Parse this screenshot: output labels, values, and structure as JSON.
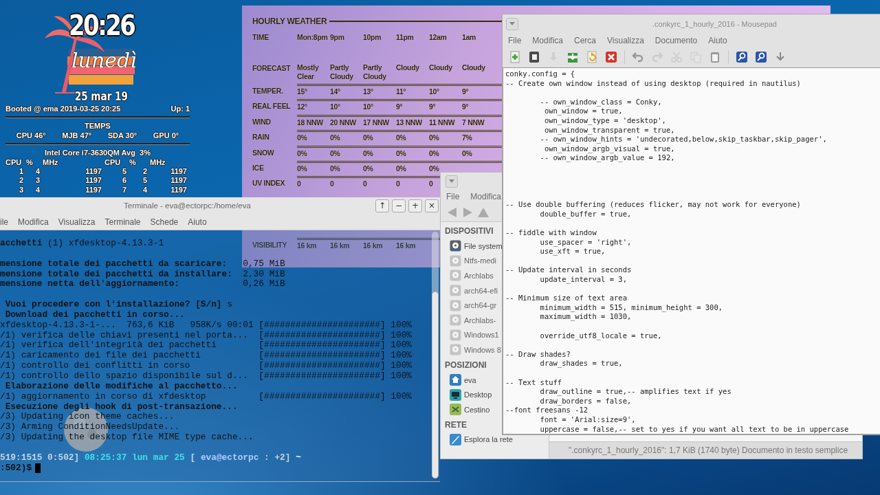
{
  "conky_clock": {
    "time": "20:26",
    "day": "lunedì",
    "date": "25 mar 19"
  },
  "conky_system": {
    "booted": "Booted @ ema 2019-03-25 20:25",
    "uptime": "Up: 1",
    "temps_title": "TEMPS",
    "temps": [
      "CPU 46°",
      "MJB 47°",
      "SDA 30°",
      "GPU 0°"
    ],
    "cpu_title": "Intel Core i7-3630QM Avg  3%",
    "cpu_headers": [
      "CPU",
      "%",
      "MHz",
      "CPU",
      "%",
      "MHz"
    ],
    "cpu_rows": [
      [
        "1",
        "4",
        "1197",
        "5",
        "2",
        "1197"
      ],
      [
        "2",
        "3",
        "1197",
        "6",
        "5",
        "1197"
      ],
      [
        "3",
        "4",
        "1197",
        "7",
        "4",
        "1197"
      ]
    ]
  },
  "weather": {
    "title": "HOURLY WEATHER",
    "rows": [
      {
        "label": "TIME",
        "values": [
          "Mon:8pm",
          "9pm",
          "10pm",
          "11pm",
          "12am",
          "1am"
        ]
      },
      {
        "label": "FORECAST",
        "values": [
          "Mostly Clear",
          "Partly Cloudy",
          "Partly Cloudy",
          "Cloudy",
          "Cloudy",
          "Cloudy"
        ]
      },
      {
        "label": "TEMPER.",
        "values": [
          "15°",
          "14°",
          "13°",
          "11°",
          "10°",
          "9°"
        ]
      },
      {
        "label": "REAL FEEL",
        "values": [
          "12°",
          "10°",
          "10°",
          "9°",
          "9°",
          "9°"
        ]
      },
      {
        "label": "WIND",
        "values": [
          "18 NNW",
          "20 NNW",
          "17 NNW",
          "13 NNW",
          "11 NNW",
          "7 NNW"
        ]
      },
      {
        "label": "RAIN",
        "values": [
          "0%",
          "0%",
          "0%",
          "0%",
          "0%",
          "7%"
        ]
      },
      {
        "label": "SNOW",
        "values": [
          "0%",
          "0%",
          "0%",
          "0%",
          "0%",
          "0%"
        ]
      },
      {
        "label": "ICE",
        "values": [
          "0%",
          "0%",
          "0%",
          "0%",
          "0%"
        ]
      },
      {
        "label": "UV INDEX",
        "values": [
          "0",
          "0",
          "0",
          "0",
          "0"
        ]
      }
    ],
    "lower_rows": [
      {
        "label": "VISIBILITY",
        "values": [
          "16 km",
          "16 km",
          "16 km",
          "16 km"
        ]
      }
    ]
  },
  "thunar": {
    "menu": [
      "File",
      "Modifica"
    ],
    "sidebar": [
      {
        "title": "DISPOSITIVI",
        "items": [
          {
            "label": "File system",
            "kind": "drive",
            "mounted": true
          },
          {
            "label": "Ntfs-medi",
            "kind": "drive",
            "mounted": false
          },
          {
            "label": "Archlabs",
            "kind": "drive",
            "mounted": false
          },
          {
            "label": "arch64-efi",
            "kind": "drive",
            "mounted": false
          },
          {
            "label": "arch64-gr",
            "kind": "drive",
            "mounted": false
          },
          {
            "label": "Archlabs-",
            "kind": "drive",
            "mounted": false
          },
          {
            "label": "Windows1",
            "kind": "drive",
            "mounted": false
          },
          {
            "label": "Windows 8",
            "kind": "drive",
            "mounted": false
          }
        ]
      },
      {
        "title": "POSIZIONI",
        "items": [
          {
            "label": "eva",
            "kind": "home"
          },
          {
            "label": "Desktop",
            "kind": "desktop"
          },
          {
            "label": "Cestino",
            "kind": "trash"
          }
        ]
      },
      {
        "title": "RETE",
        "items": [
          {
            "label": "Esplora la rete",
            "kind": "network"
          }
        ]
      }
    ],
    "status": "\".conkyrc_1_hourly_2016\": 1,7 KiB (1740 byte) Documento in testo semplice"
  },
  "mousepad": {
    "title": ".conkyrc_1_hourly_2016 - Mousepad",
    "menu": [
      "File",
      "Modifica",
      "Cerca",
      "Visualizza",
      "Documento",
      "Aiuto"
    ],
    "toolbar": [
      [
        {
          "kind": "new",
          "disabled": false
        },
        {
          "kind": "open",
          "disabled": false
        },
        {
          "kind": "save",
          "disabled": true
        },
        {
          "kind": "save_as",
          "disabled": false
        },
        {
          "kind": "reload",
          "disabled": false
        },
        {
          "kind": "close",
          "disabled": false
        }
      ],
      [
        {
          "kind": "undo",
          "disabled": false
        },
        {
          "kind": "redo",
          "disabled": true
        },
        {
          "kind": "cut",
          "disabled": true
        },
        {
          "kind": "copy",
          "disabled": true
        },
        {
          "kind": "paste",
          "disabled": false
        }
      ],
      [
        {
          "kind": "find",
          "disabled": false
        },
        {
          "kind": "replace",
          "disabled": false
        },
        {
          "kind": "goto",
          "disabled": false
        }
      ]
    ],
    "text": "conky.config = {\n-- Create own window instead of using desktop (required in nautilus)\n\n        -- own_window_class = Conky,\n         own_window = true,\n         own_window_type = 'desktop',\n         own_window_transparent = true,\n        -- own_window_hints = 'undecorated,below,skip_taskbar,skip_pager',\n         own_window_argb_visual = true,\n        -- own_window_argb_value = 192,\n\n\n\n\n-- Use double buffering (reduces flicker, may not work for everyone)\n        double_buffer = true,\n\n-- fiddle with window\n        use_spacer = 'right',\n        use_xft = true,\n\n-- Update interval in seconds\n        update_interval = 3,\n\n-- Minimum size of text area\n        minimum_width = 515, minimum_height = 300,\n        maximum_width = 1030,\n\n        override_utf8_locale = true,\n\n-- Draw shades?\n        draw_shades = true,\n\n-- Text stuff\n        draw_outline = true,-- amplifies text if yes\n        draw_borders = false,\n--font freesans -12\n        font = 'Arial:size=9',\n        uppercase = false,-- set to yes if you want all text to be in uppercase"
  },
  "terminal": {
    "title": "Terminale - eva@ectorpc:/home/eva",
    "buttons": [
      "↑",
      "−",
      "+",
      "×"
    ],
    "menu": [
      "ile",
      "Modifica",
      "Visualizza",
      "Terminale",
      "Schede",
      "Aiuto"
    ],
    "lines": [
      {
        "kind": "out",
        "text": "**acchetti** (1) xfdesktop-4.13.3-1"
      },
      {
        "kind": "blank"
      },
      {
        "kind": "out",
        "text": "**mensione totale dei pacchetti da scaricare:**   0,75 MiB"
      },
      {
        "kind": "out",
        "text": "**mensione totale dei pacchetti da installare:**  2,30 MiB"
      },
      {
        "kind": "out",
        "text": "**mensione netta dell'aggiornamento:**            0,26 MiB"
      },
      {
        "kind": "blank"
      },
      {
        "kind": "out",
        "text": " **Vuoi procedere con l'installazione? [S/n]** s"
      },
      {
        "kind": "out",
        "text": " **Download dei pacchetti in corso...**"
      },
      {
        "kind": "out",
        "text": "xfdesktop-4.13.3-1-...  763,6 KiB   958K/s 00:01 [######################] 100%"
      },
      {
        "kind": "out",
        "text": "/1) verifica delle chiavi presenti nel porta...  [######################] 100%"
      },
      {
        "kind": "out",
        "text": "/1) verifica dell'integrità dei pacchetti        [######################] 100%"
      },
      {
        "kind": "out",
        "text": "/1) caricamento dei file dei pacchetti           [######################] 100%"
      },
      {
        "kind": "out",
        "text": "/1) controllo dei conflitti in corso             [######################] 100%"
      },
      {
        "kind": "out",
        "text": "/1) controllo dello spazio disponibile sul d...  [######################] 100%"
      },
      {
        "kind": "out",
        "text": " **Elaborazione delle modifiche al pacchetto...**"
      },
      {
        "kind": "out",
        "text": "/1) aggiornamento in corso di xfdesktop          [######################] 100%"
      },
      {
        "kind": "out",
        "text": " **Esecuzione degli hook di post-transazione...**"
      },
      {
        "kind": "out",
        "text": "/3) Updating icon theme caches..."
      },
      {
        "kind": "out",
        "text": "/3) Arming ConditionNeedsUpdate..."
      },
      {
        "kind": "out",
        "text": "/3) Updating the desktop file MIME type cache..."
      },
      {
        "kind": "blank"
      },
      {
        "kind": "prompt",
        "segments": [
          {
            "text": "519:1515 0:502]",
            "color": "#c4d4e4"
          },
          {
            "text": "08:25:37 lun mar 25",
            "color": "#3ee0e8"
          },
          {
            "text": "[",
            "color": "#c4d4e4"
          },
          {
            "text": "eva@ectorpc",
            "color": "#b0ccff"
          },
          {
            "text": ": +2]",
            "color": "#c4d4e4"
          },
          {
            "text": "~",
            "color": "#ffffff"
          }
        ]
      },
      {
        "kind": "input",
        "text": ":502)$"
      }
    ]
  }
}
